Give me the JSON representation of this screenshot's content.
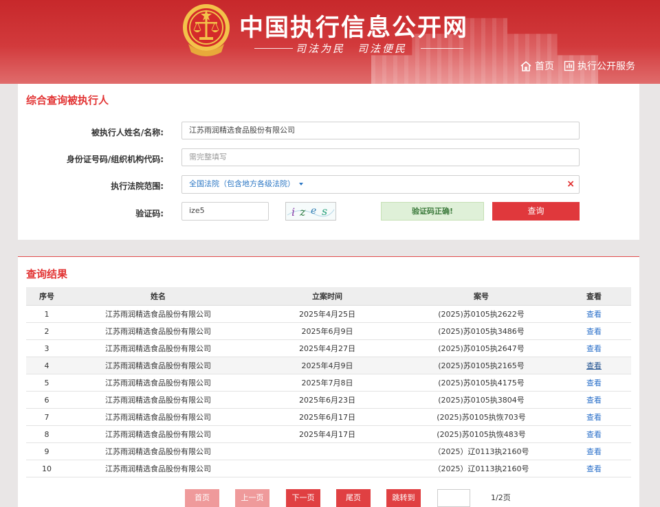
{
  "header": {
    "site_title": "中国执行信息公开网",
    "slogan": "司法为民　司法便民",
    "nav": [
      {
        "label": "首页",
        "icon": "home-icon"
      },
      {
        "label": "执行公开服务",
        "icon": "chart-icon"
      }
    ]
  },
  "search": {
    "title": "综合查询被执行人",
    "name_label": "被执行人姓名/名称:",
    "name_value": "江苏雨润精选食品股份有限公司",
    "id_label": "身份证号码/组织机构代码:",
    "id_placeholder": "需完整填写",
    "court_label": "执行法院范围:",
    "court_value": "全国法院（包含地方各级法院）",
    "clear": "×",
    "captcha_label": "验证码:",
    "captcha_value": "ize5",
    "captcha_image_text": "izes",
    "captcha_status": "验证码正确!",
    "query_button": "查询"
  },
  "results": {
    "title": "查询结果",
    "columns": [
      "序号",
      "姓名",
      "立案时间",
      "案号",
      "查看"
    ],
    "rows": [
      {
        "no": "1",
        "name": "江苏雨润精选食品股份有限公司",
        "date": "2025年4月25日",
        "case": "(2025)苏0105执2622号",
        "view": "查看"
      },
      {
        "no": "2",
        "name": "江苏雨润精选食品股份有限公司",
        "date": "2025年6月9日",
        "case": "(2025)苏0105执3486号",
        "view": "查看"
      },
      {
        "no": "3",
        "name": "江苏雨润精选食品股份有限公司",
        "date": "2025年4月27日",
        "case": "(2025)苏0105执2647号",
        "view": "查看"
      },
      {
        "no": "4",
        "name": "江苏雨润精选食品股份有限公司",
        "date": "2025年4月9日",
        "case": "(2025)苏0105执2165号",
        "view": "查看"
      },
      {
        "no": "5",
        "name": "江苏雨润精选食品股份有限公司",
        "date": "2025年7月8日",
        "case": "(2025)苏0105执4175号",
        "view": "查看"
      },
      {
        "no": "6",
        "name": "江苏雨润精选食品股份有限公司",
        "date": "2025年6月23日",
        "case": "(2025)苏0105执3804号",
        "view": "查看"
      },
      {
        "no": "7",
        "name": "江苏雨润精选食品股份有限公司",
        "date": "2025年6月17日",
        "case": "(2025)苏0105执恢703号",
        "view": "查看"
      },
      {
        "no": "8",
        "name": "江苏雨润精选食品股份有限公司",
        "date": "2025年4月17日",
        "case": "(2025)苏0105执恢483号",
        "view": "查看"
      },
      {
        "no": "9",
        "name": "江苏雨润精选食品股份有限公司",
        "date": "",
        "case": "（2025）辽0113执2160号",
        "view": "查看"
      },
      {
        "no": "10",
        "name": "江苏雨润精选食品股份有限公司",
        "date": "",
        "case": "（2025）辽0113执2160号",
        "view": "查看"
      }
    ]
  },
  "pagination": {
    "first": "首页",
    "prev": "上一页",
    "next": "下一页",
    "last": "尾页",
    "jump": "跳转到",
    "info": "1/2页"
  }
}
